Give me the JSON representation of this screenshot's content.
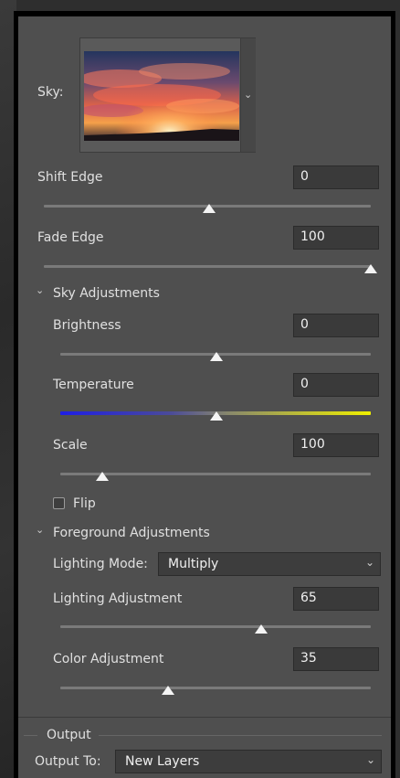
{
  "sky": {
    "label": "Sky:"
  },
  "shift_edge": {
    "label": "Shift Edge",
    "value": "0",
    "level": 0.5
  },
  "fade_edge": {
    "label": "Fade Edge",
    "value": "100",
    "level": 1.0
  },
  "sky_adjustments": {
    "header": "Sky Adjustments",
    "brightness": {
      "label": "Brightness",
      "value": "0",
      "level": 0.5
    },
    "temperature": {
      "label": "Temperature",
      "value": "0",
      "level": 0.5,
      "color_left": "#1e1ee6",
      "color_right": "#f0f000"
    },
    "scale": {
      "label": "Scale",
      "value": "100",
      "level": 0.14
    },
    "flip": {
      "label": "Flip",
      "checked": false
    }
  },
  "foreground_adjustments": {
    "header": "Foreground Adjustments",
    "lighting_mode": {
      "label": "Lighting Mode:",
      "value": "Multiply"
    },
    "lighting_adjustment": {
      "label": "Lighting Adjustment",
      "value": "65",
      "level": 0.65
    },
    "color_adjustment": {
      "label": "Color Adjustment",
      "value": "35",
      "level": 0.35
    }
  },
  "output": {
    "group_label": "Output",
    "output_to_label": "Output To:",
    "output_to_value": "New Layers"
  },
  "icons": {
    "sky_dropdown": "chevron-down-icon",
    "section_toggle": "chevron-down-icon",
    "slider_thumb": "triangle-thumb-icon"
  }
}
